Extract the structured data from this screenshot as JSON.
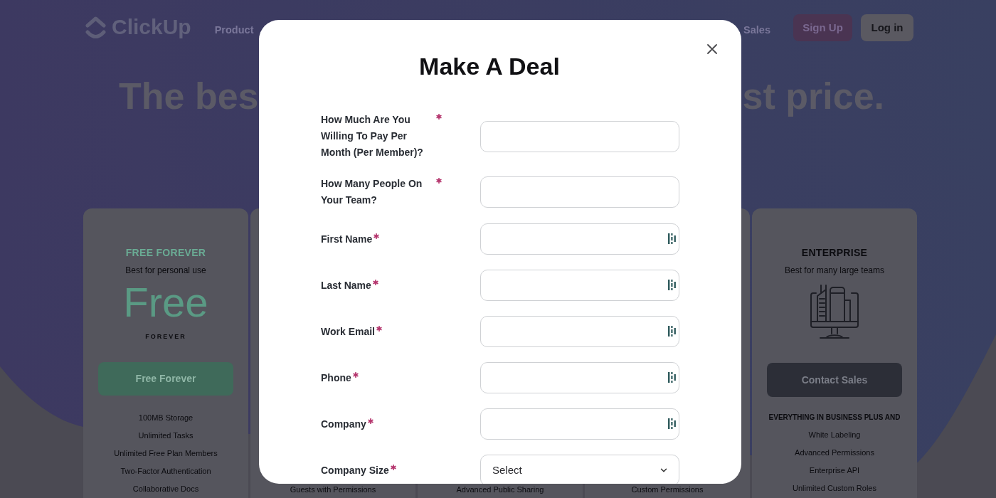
{
  "header": {
    "logo": "ClickUp",
    "nav_left": [
      {
        "label": "Product"
      }
    ],
    "nav_right": [
      {
        "label": "Sales"
      }
    ],
    "buttons": [
      {
        "label": "Sign Up",
        "kind": "signup"
      },
      {
        "label": "Log in",
        "kind": "login"
      }
    ]
  },
  "hero": {
    "headline_left": "The bes",
    "headline_right": "st price."
  },
  "plans": [
    {
      "kind": "free",
      "title": "FREE FOREVER",
      "subtitle": "Best for personal use",
      "price": "Free",
      "price_note": "FOREVER",
      "button": "Free Forever",
      "features": [
        "100MB Storage",
        "Unlimited Tasks",
        "Unlimited Free Plan Members",
        "Two-Factor Authentication",
        "Collaborative Docs"
      ]
    },
    {
      "kind": "covered",
      "features": [
        "Guests with Permissions"
      ]
    },
    {
      "kind": "covered",
      "features": [
        "Advanced Public Sharing"
      ]
    },
    {
      "kind": "covered",
      "features": [
        "Custom Permissions"
      ]
    },
    {
      "kind": "enterprise",
      "title": "ENTERPRISE",
      "subtitle": "Best for many large teams",
      "button": "Contact Sales",
      "features_heading": "EVERYTHING IN BUSINESS PLUS AND",
      "features": [
        "White Labeling",
        "Advanced Permissions",
        "Enterprise API",
        "Unlimited Custom Roles"
      ]
    }
  ],
  "modal": {
    "title": "Make A Deal",
    "fields": [
      {
        "label": "How Much Are You Willing To Pay Per Month (Per Member)?",
        "kind": "plain",
        "required": true
      },
      {
        "label": "How Many People On Your Team?",
        "kind": "plain",
        "required": true
      },
      {
        "label": "First Name",
        "kind": "autofill",
        "required": true
      },
      {
        "label": "Last Name",
        "kind": "autofill",
        "required": true
      },
      {
        "label": "Work Email",
        "kind": "autofill",
        "required": true
      },
      {
        "label": "Phone",
        "kind": "autofill",
        "required": true
      },
      {
        "label": "Company",
        "kind": "autofill",
        "required": true
      },
      {
        "label": "Company Size",
        "kind": "select",
        "required": true,
        "value": "Select"
      }
    ]
  }
}
